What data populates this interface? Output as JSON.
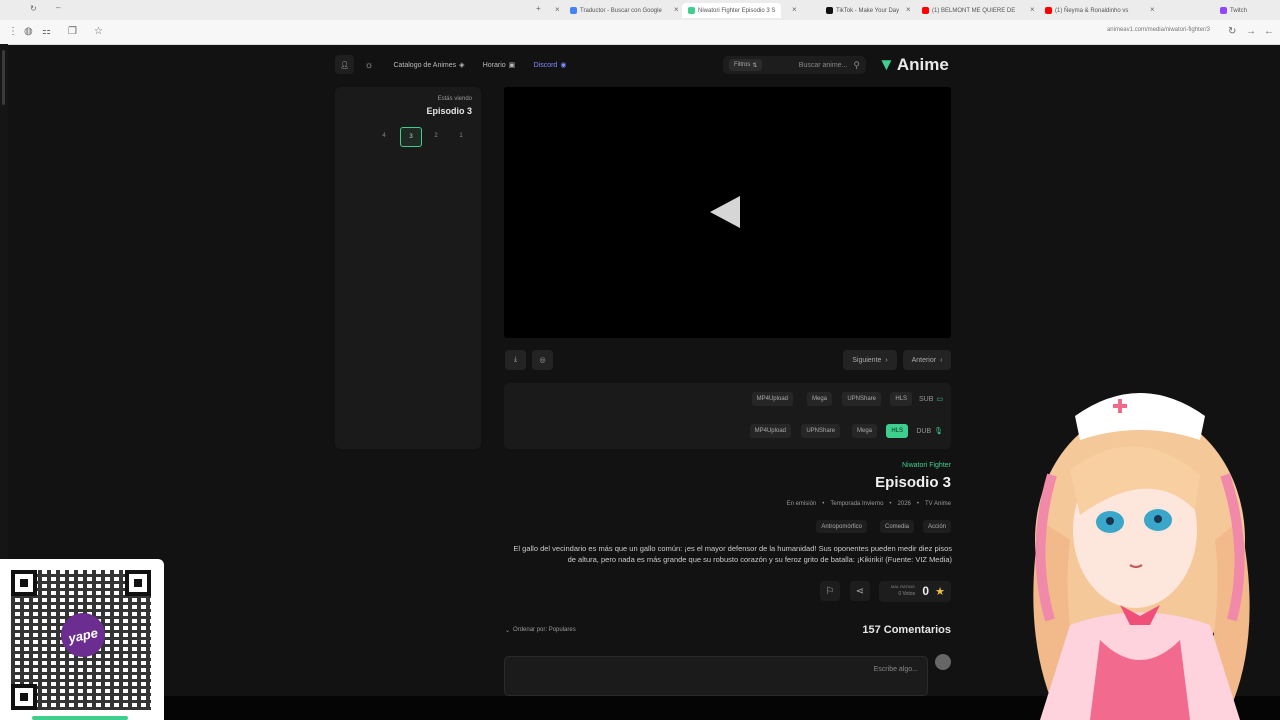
{
  "browser": {
    "tabs": [
      {
        "label": "Twitch",
        "color": "#9146ff"
      },
      {
        "label": "(1) Ñeyma & Ronaldinho vs",
        "color": "#ff0000"
      },
      {
        "label": "(1) BELMONT ME QUIERE DE",
        "color": "#ff0000"
      },
      {
        "label": "TikTok - Make Your Day",
        "color": "#111111"
      },
      {
        "label": "Niwatori Fighter Episodio 3 S",
        "color": "#3ecf8e"
      },
      {
        "label": "Traductor - Buscar con Google",
        "color": "#4285f4"
      }
    ],
    "url": "animeav1.com/media/niwatori-fighter/3"
  },
  "nav": {
    "logo": "Anime",
    "search_placeholder": "Buscar anime...",
    "filters_label": "Filtros",
    "discord_label": "Discord",
    "schedule_label": "Horario",
    "catalog_label": "Catalogo de Animes"
  },
  "sidebar": {
    "watching_label": "Estás viendo",
    "current_episode": "Episodio 3",
    "episodes": [
      "1",
      "2",
      "3",
      "4"
    ]
  },
  "player": {
    "prev_label": "Anterior",
    "next_label": "Siguiente"
  },
  "servers": {
    "sub_label": "SUB",
    "dub_label": "DUB",
    "sub_servers": [
      "HLS",
      "UPNShare",
      "Mega",
      "MP4Upload"
    ],
    "dub_servers": [
      "HLS",
      "Mega",
      "UPNShare",
      "MP4Upload"
    ]
  },
  "info": {
    "series": "Niwatori Fighter",
    "episode_title": "Episodio 3",
    "meta": [
      "TV Anime",
      "2026",
      "Temporada Invierno",
      "En emisión"
    ],
    "genres": [
      "Acción",
      "Comedia",
      "Antropomórfico"
    ],
    "synopsis": "El gallo del vecindario es más que un gallo común: ¡es el mayor defensor de la humanidad! Sus oponentes pueden medir diez pisos de altura, pero nada es más grande que su robusto corazón y su feroz grito de batalla: ¡Kikiriki! (Fuente: VIZ Media)",
    "rating_value": "0",
    "rating_votes": "0 Votos",
    "rating_caption": "MAL RATING"
  },
  "comments": {
    "title": "157 Comentarios",
    "sort_label": "Ordenar por: Populares",
    "input_placeholder": "Escribe algo..."
  },
  "overlay": {
    "qr_brand": "yape"
  },
  "colors": {
    "accent": "#3ecf8e",
    "background": "#121212",
    "panel": "#1a1a1a"
  }
}
